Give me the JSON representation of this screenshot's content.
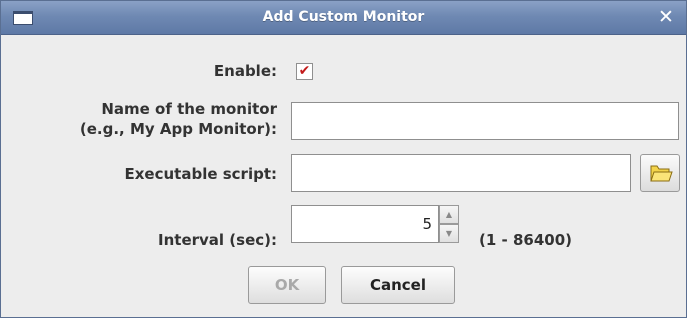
{
  "window": {
    "title": "Add Custom Monitor",
    "close_glyph": "✕"
  },
  "form": {
    "enable_label": "Enable:",
    "enable_checked": true,
    "name_label_line1": "Name of the monitor",
    "name_label_line2": "(e.g., My App Monitor):",
    "name_value": "",
    "script_label": "Executable script:",
    "script_value": "",
    "interval_label": "Interval (sec):",
    "interval_value": "5",
    "interval_range": "(1 - 86400)"
  },
  "buttons": {
    "ok_label": "OK",
    "cancel_label": "Cancel"
  },
  "icons": {
    "checkmark": "check-icon",
    "browse": "folder-icon",
    "spin_up": "chevron-up-icon",
    "spin_down": "chevron-down-icon"
  },
  "colors": {
    "titlebar": "#6f89b3",
    "check": "#c21a1a",
    "disabled_text": "#a9a9a9"
  }
}
